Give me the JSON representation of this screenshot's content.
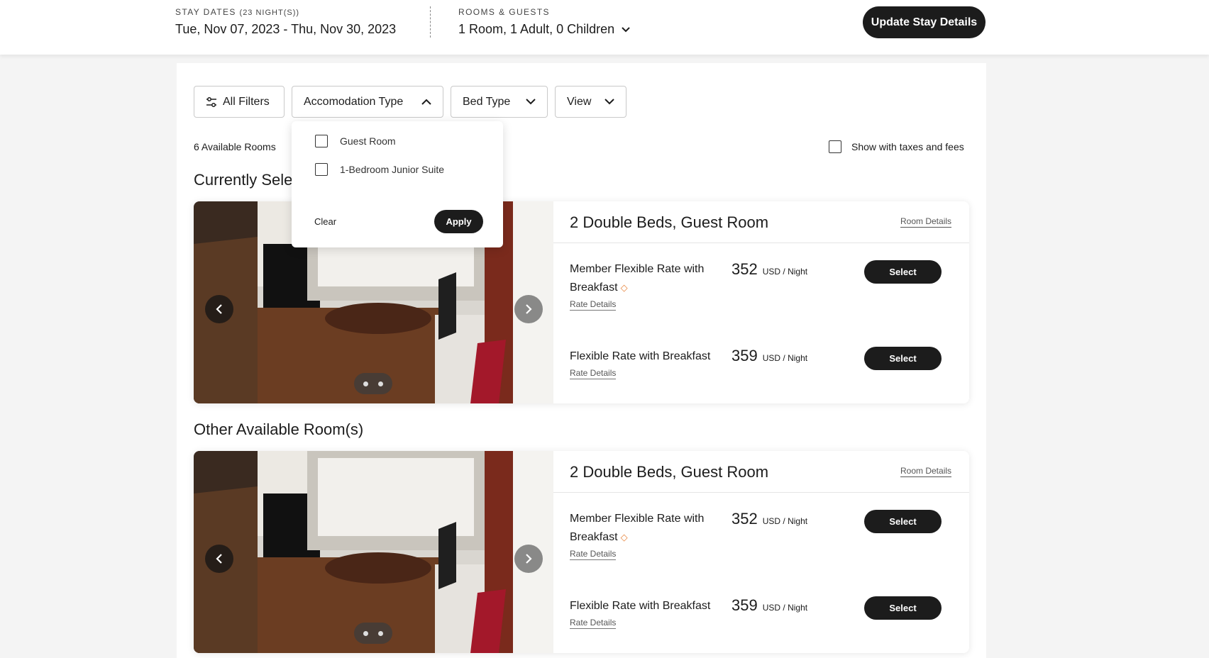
{
  "header": {
    "stay_label": "Stay Dates",
    "stay_nights": "(23 Night(s))",
    "stay_dates": "Tue, Nov 07, 2023 - Thu, Nov 30, 2023",
    "rooms_label": "Rooms & Guests",
    "rooms_value": "1 Room, 1 Adult, 0 Children",
    "update_button": "Update Stay Details"
  },
  "filters": {
    "all_filters": "All Filters",
    "accommodation_type": "Accomodation Type",
    "bed_type": "Bed Type",
    "view": "View"
  },
  "dropdown": {
    "options": [
      {
        "label": "Guest Room",
        "checked": false
      },
      {
        "label": "1-Bedroom Junior Suite",
        "checked": false
      }
    ],
    "clear": "Clear",
    "apply": "Apply"
  },
  "results": {
    "available_count": "6 Available Rooms",
    "taxes_label": "Show with taxes and fees",
    "currently_selected": "Currently Sele",
    "other_rooms": "Other Available Room(s)"
  },
  "rooms": [
    {
      "title": "2 Double Beds, Guest Room",
      "details_link": "Room Details",
      "image_count": 2,
      "rates": [
        {
          "name": "Member Flexible Rate with Breakfast",
          "details_link": "Rate Details",
          "price": "352",
          "unit_currency": "USD",
          "unit_suffix": "/ Night",
          "select": "Select",
          "member_tag": true
        },
        {
          "name": "Flexible Rate with Breakfast",
          "details_link": "Rate Details",
          "price": "359",
          "unit_currency": "USD",
          "unit_suffix": "/ Night",
          "select": "Select",
          "member_tag": false
        }
      ]
    },
    {
      "title": "2 Double Beds, Guest Room",
      "details_link": "Room Details",
      "image_count": 2,
      "rates": [
        {
          "name": "Member Flexible Rate with Breakfast",
          "details_link": "Rate Details",
          "price": "352",
          "unit_currency": "USD",
          "unit_suffix": "/ Night",
          "select": "Select",
          "member_tag": true
        },
        {
          "name": "Flexible Rate with Breakfast",
          "details_link": "Rate Details",
          "price": "359",
          "unit_currency": "USD",
          "unit_suffix": "/ Night",
          "select": "Select",
          "member_tag": false
        }
      ]
    }
  ],
  "colors": {
    "accent_dark": "#1c1c1c",
    "tag_orange": "#e8843c",
    "page_bg": "#f4f4f4"
  }
}
